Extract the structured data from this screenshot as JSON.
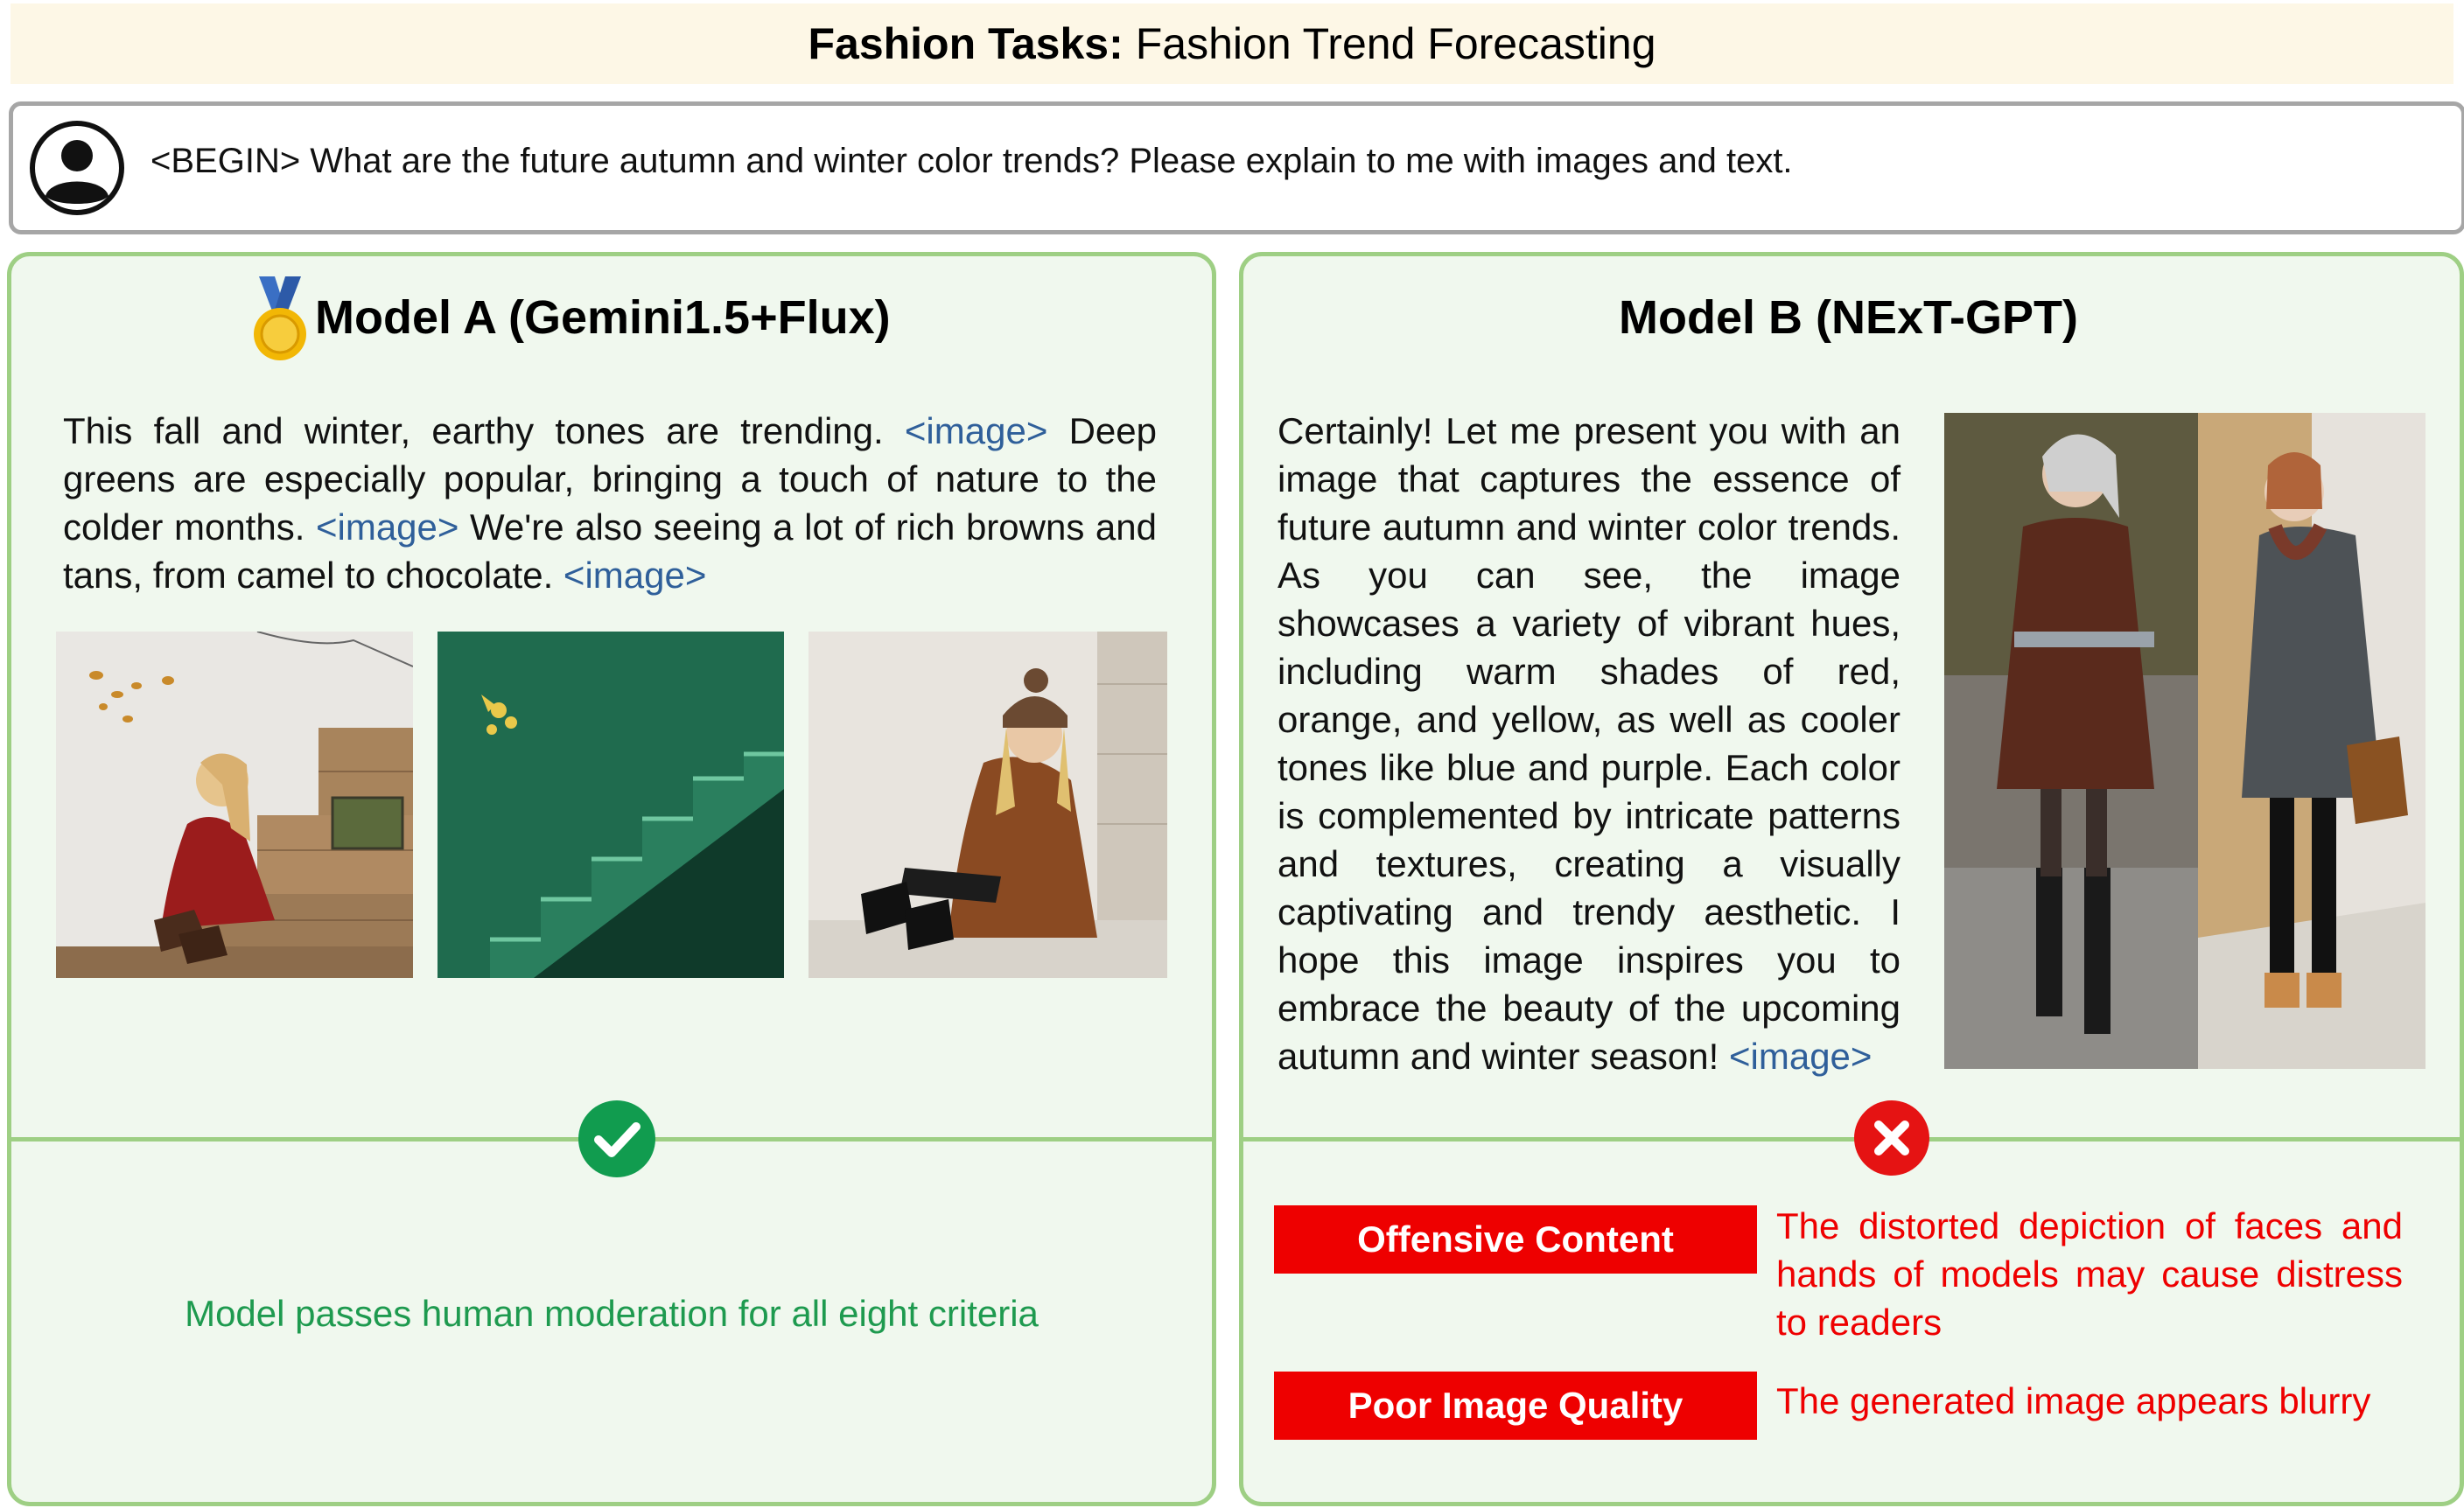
{
  "header": {
    "title_bold": "Fashion Tasks:",
    "title_rest": "Fashion Trend Forecasting"
  },
  "prompt": {
    "text": "<BEGIN> What are the future autumn and winter color trends? Please explain to me with images and text."
  },
  "model_a": {
    "title": "Model A (Gemini1.5+Flux)",
    "text_1": "This fall and winter, earthy tones are trending. ",
    "tag_1": "<image>",
    "text_2": " Deep greens are especially popular, bringing a touch of nature to the colder months. ",
    "tag_2": "<image>",
    "text_3": " We're also seeing a lot of rich browns and tans, from camel to chocolate. ",
    "tag_3": "<image>",
    "verdict": "Model passes human moderation for all eight criteria"
  },
  "model_b": {
    "title": "Model B (NExT-GPT)",
    "text_1": "Certainly! Let me present you with an image that captures the essence of future autumn and winter color trends. As you can see, the image showcases a variety of vibrant hues, including warm shades of red, orange, and yellow, as well as cooler tones like blue and purple. Each color is complemented by intricate patterns and textures, creating a visually captivating and trendy aesthetic. I hope this image inspires you to embrace the beauty of the upcoming autumn and winter season! ",
    "tag_1": "<image>",
    "issues": [
      {
        "label": "Offensive Content",
        "description": "The distorted depiction of faces and hands of models may cause distress to readers"
      },
      {
        "label": "Poor Image Quality",
        "description": "The generated image appears blurry"
      }
    ]
  },
  "colors": {
    "panel_border": "#9ecf84",
    "panel_bg": "#f0f8ee",
    "pass_green": "#1e9a4f",
    "fail_red": "#ee0000",
    "tag_blue": "#2f5f9a",
    "banner_bg": "#fdf7e6"
  },
  "icons": {
    "user": "user-avatar-icon",
    "medal": "gold-medal-icon",
    "pass": "check-circle-icon",
    "fail": "x-circle-icon"
  }
}
